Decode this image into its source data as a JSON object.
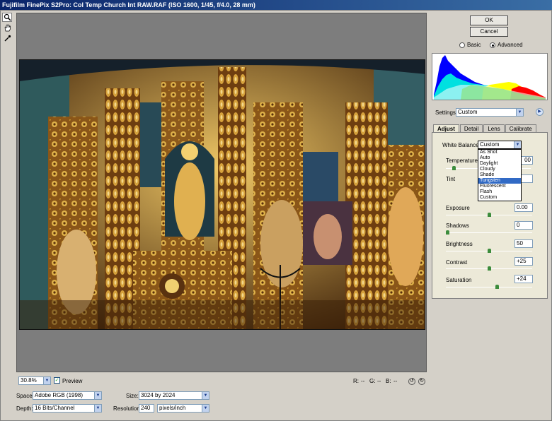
{
  "window": {
    "title": "Fujifilm FinePix S2Pro:  Col Temp Church Int RAW.RAF  (ISO 1600, 1/45, f/4.0, 28 mm)"
  },
  "buttons": {
    "ok": "OK",
    "cancel": "Cancel"
  },
  "mode": {
    "basic": "Basic",
    "advanced": "Advanced",
    "selected": "Advanced"
  },
  "settings": {
    "label": "Settings:",
    "value": "Custom"
  },
  "tabs": [
    "Adjust",
    "Detail",
    "Lens",
    "Calibrate"
  ],
  "white_balance": {
    "label": "White Balance:",
    "value": "Custom",
    "options": [
      "As Shot",
      "Auto",
      "Daylight",
      "Cloudy",
      "Shade",
      "Tungsten",
      "Fluorescent",
      "Flash",
      "Custom"
    ],
    "highlighted": "Tungsten"
  },
  "temperature": {
    "label": "Temperature",
    "value": "00",
    "level": 0.08
  },
  "tint": {
    "label": "Tint",
    "value": ""
  },
  "exposure": {
    "label": "Exposure",
    "value": "0.00",
    "level": 0.5
  },
  "shadows": {
    "label": "Shadows",
    "value": "0",
    "level": 0.0
  },
  "brightness": {
    "label": "Brightness",
    "value": "50",
    "level": 0.5
  },
  "contrast": {
    "label": "Contrast",
    "value": "+25",
    "level": 0.5
  },
  "saturation": {
    "label": "Saturation",
    "value": "+24",
    "level": 0.6
  },
  "status": {
    "zoom": "30.8%",
    "preview_label": "Preview",
    "preview_checked": true,
    "r_label": "R:",
    "g_label": "G:",
    "b_label": "B:",
    "r_value": "--",
    "g_value": "--",
    "b_value": "--"
  },
  "output": {
    "space_label": "Space:",
    "space_value": "Adobe RGB (1998)",
    "depth_label": "Depth:",
    "depth_value": "16 Bits/Channel",
    "size_label": "Size:",
    "size_value": "3024 by 2024",
    "resolution_label": "Resolution:",
    "resolution_value": "240",
    "resolution_unit": "pixels/inch"
  },
  "icons": {
    "zoom": "magnifier-icon",
    "hand": "hand-icon",
    "eyedropper": "eyedropper-icon",
    "settings_menu": "round-arrow-menu-icon",
    "rotate_left": "rotate-left-icon",
    "rotate_right": "rotate-right-icon"
  },
  "colors": {
    "title_start": "#0a246a",
    "title_end": "#3a6ea5",
    "selection": "#316ac5",
    "preview_bg": "#7d7d7d"
  }
}
